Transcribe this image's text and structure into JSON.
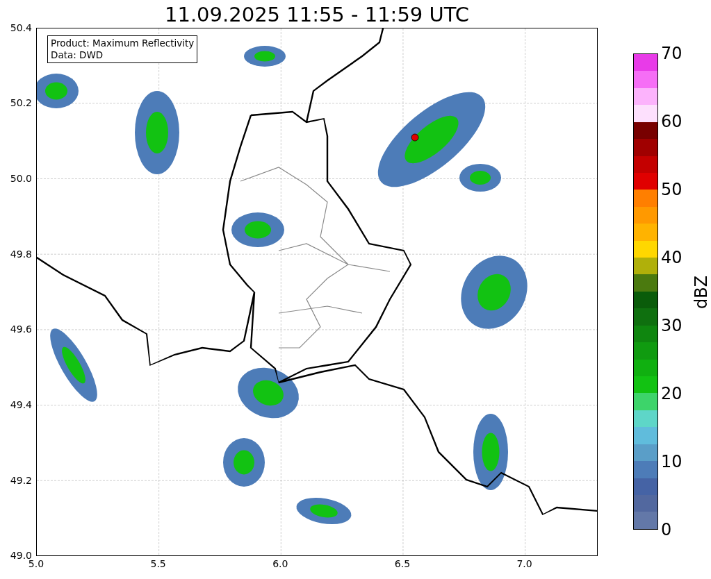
{
  "title": "11.09.2025 11:55 - 11:59 UTC",
  "map": {
    "info_box": [
      "Product: Maximum Reflectivity",
      "Data: DWD"
    ],
    "x_ticks": [
      "5.0",
      "5.5",
      "6.0",
      "6.5",
      "7.0"
    ],
    "y_ticks": [
      "50.4",
      "50.2",
      "50.0",
      "49.8",
      "49.6",
      "49.4",
      "49.2",
      "49.0"
    ]
  },
  "colorbar": {
    "label": "dBZ",
    "ticks": [
      "70",
      "60",
      "50",
      "40",
      "30",
      "20",
      "10",
      "0"
    ],
    "bands": [
      {
        "color": "#e83be8"
      },
      {
        "color": "#f66ef6"
      },
      {
        "color": "#fcb3fc"
      },
      {
        "color": "#fde0fd"
      },
      {
        "color": "#780000"
      },
      {
        "color": "#a00000"
      },
      {
        "color": "#c40000"
      },
      {
        "color": "#e00000"
      },
      {
        "color": "#ff7f00"
      },
      {
        "color": "#ff9900"
      },
      {
        "color": "#ffb300"
      },
      {
        "color": "#ffd700"
      },
      {
        "color": "#b0b00a"
      },
      {
        "color": "#4b7a0f"
      },
      {
        "color": "#0a5c0a"
      },
      {
        "color": "#0f700f"
      },
      {
        "color": "#0f860f"
      },
      {
        "color": "#109b10"
      },
      {
        "color": "#10b010"
      },
      {
        "color": "#12c212"
      },
      {
        "color": "#3dd46a"
      },
      {
        "color": "#5ed6c8"
      },
      {
        "color": "#60bcdc"
      },
      {
        "color": "#5a9ec8"
      },
      {
        "color": "#4d7cb8"
      },
      {
        "color": "#4563a5"
      },
      {
        "color": "#52689f"
      },
      {
        "color": "#6378a8"
      }
    ]
  }
}
